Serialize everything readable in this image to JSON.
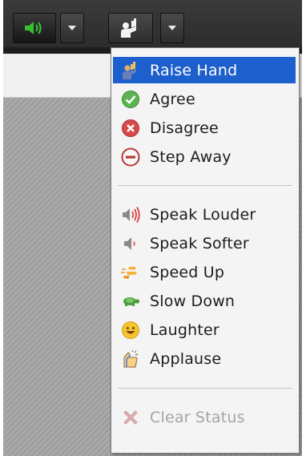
{
  "menu": {
    "status_items": [
      {
        "label": "Raise Hand",
        "icon": "raise-hand-icon",
        "selected": true
      },
      {
        "label": "Agree",
        "icon": "agree-check-icon"
      },
      {
        "label": "Disagree",
        "icon": "disagree-x-icon"
      },
      {
        "label": "Step Away",
        "icon": "step-away-icon"
      }
    ],
    "feedback_items": [
      {
        "label": "Speak Louder",
        "icon": "speak-louder-icon"
      },
      {
        "label": "Speak Softer",
        "icon": "speak-softer-icon"
      },
      {
        "label": "Speed Up",
        "icon": "speed-up-icon"
      },
      {
        "label": "Slow Down",
        "icon": "slow-down-turtle-icon"
      },
      {
        "label": "Laughter",
        "icon": "laughter-icon"
      },
      {
        "label": "Applause",
        "icon": "applause-icon"
      }
    ],
    "clear_status": {
      "label": "Clear Status",
      "icon": "clear-status-icon",
      "enabled": false
    }
  },
  "colors": {
    "selection": "#1e5fce",
    "speaker_green": "#35c133",
    "agree_green": "#5bb450",
    "disagree_red": "#d84a4a"
  }
}
